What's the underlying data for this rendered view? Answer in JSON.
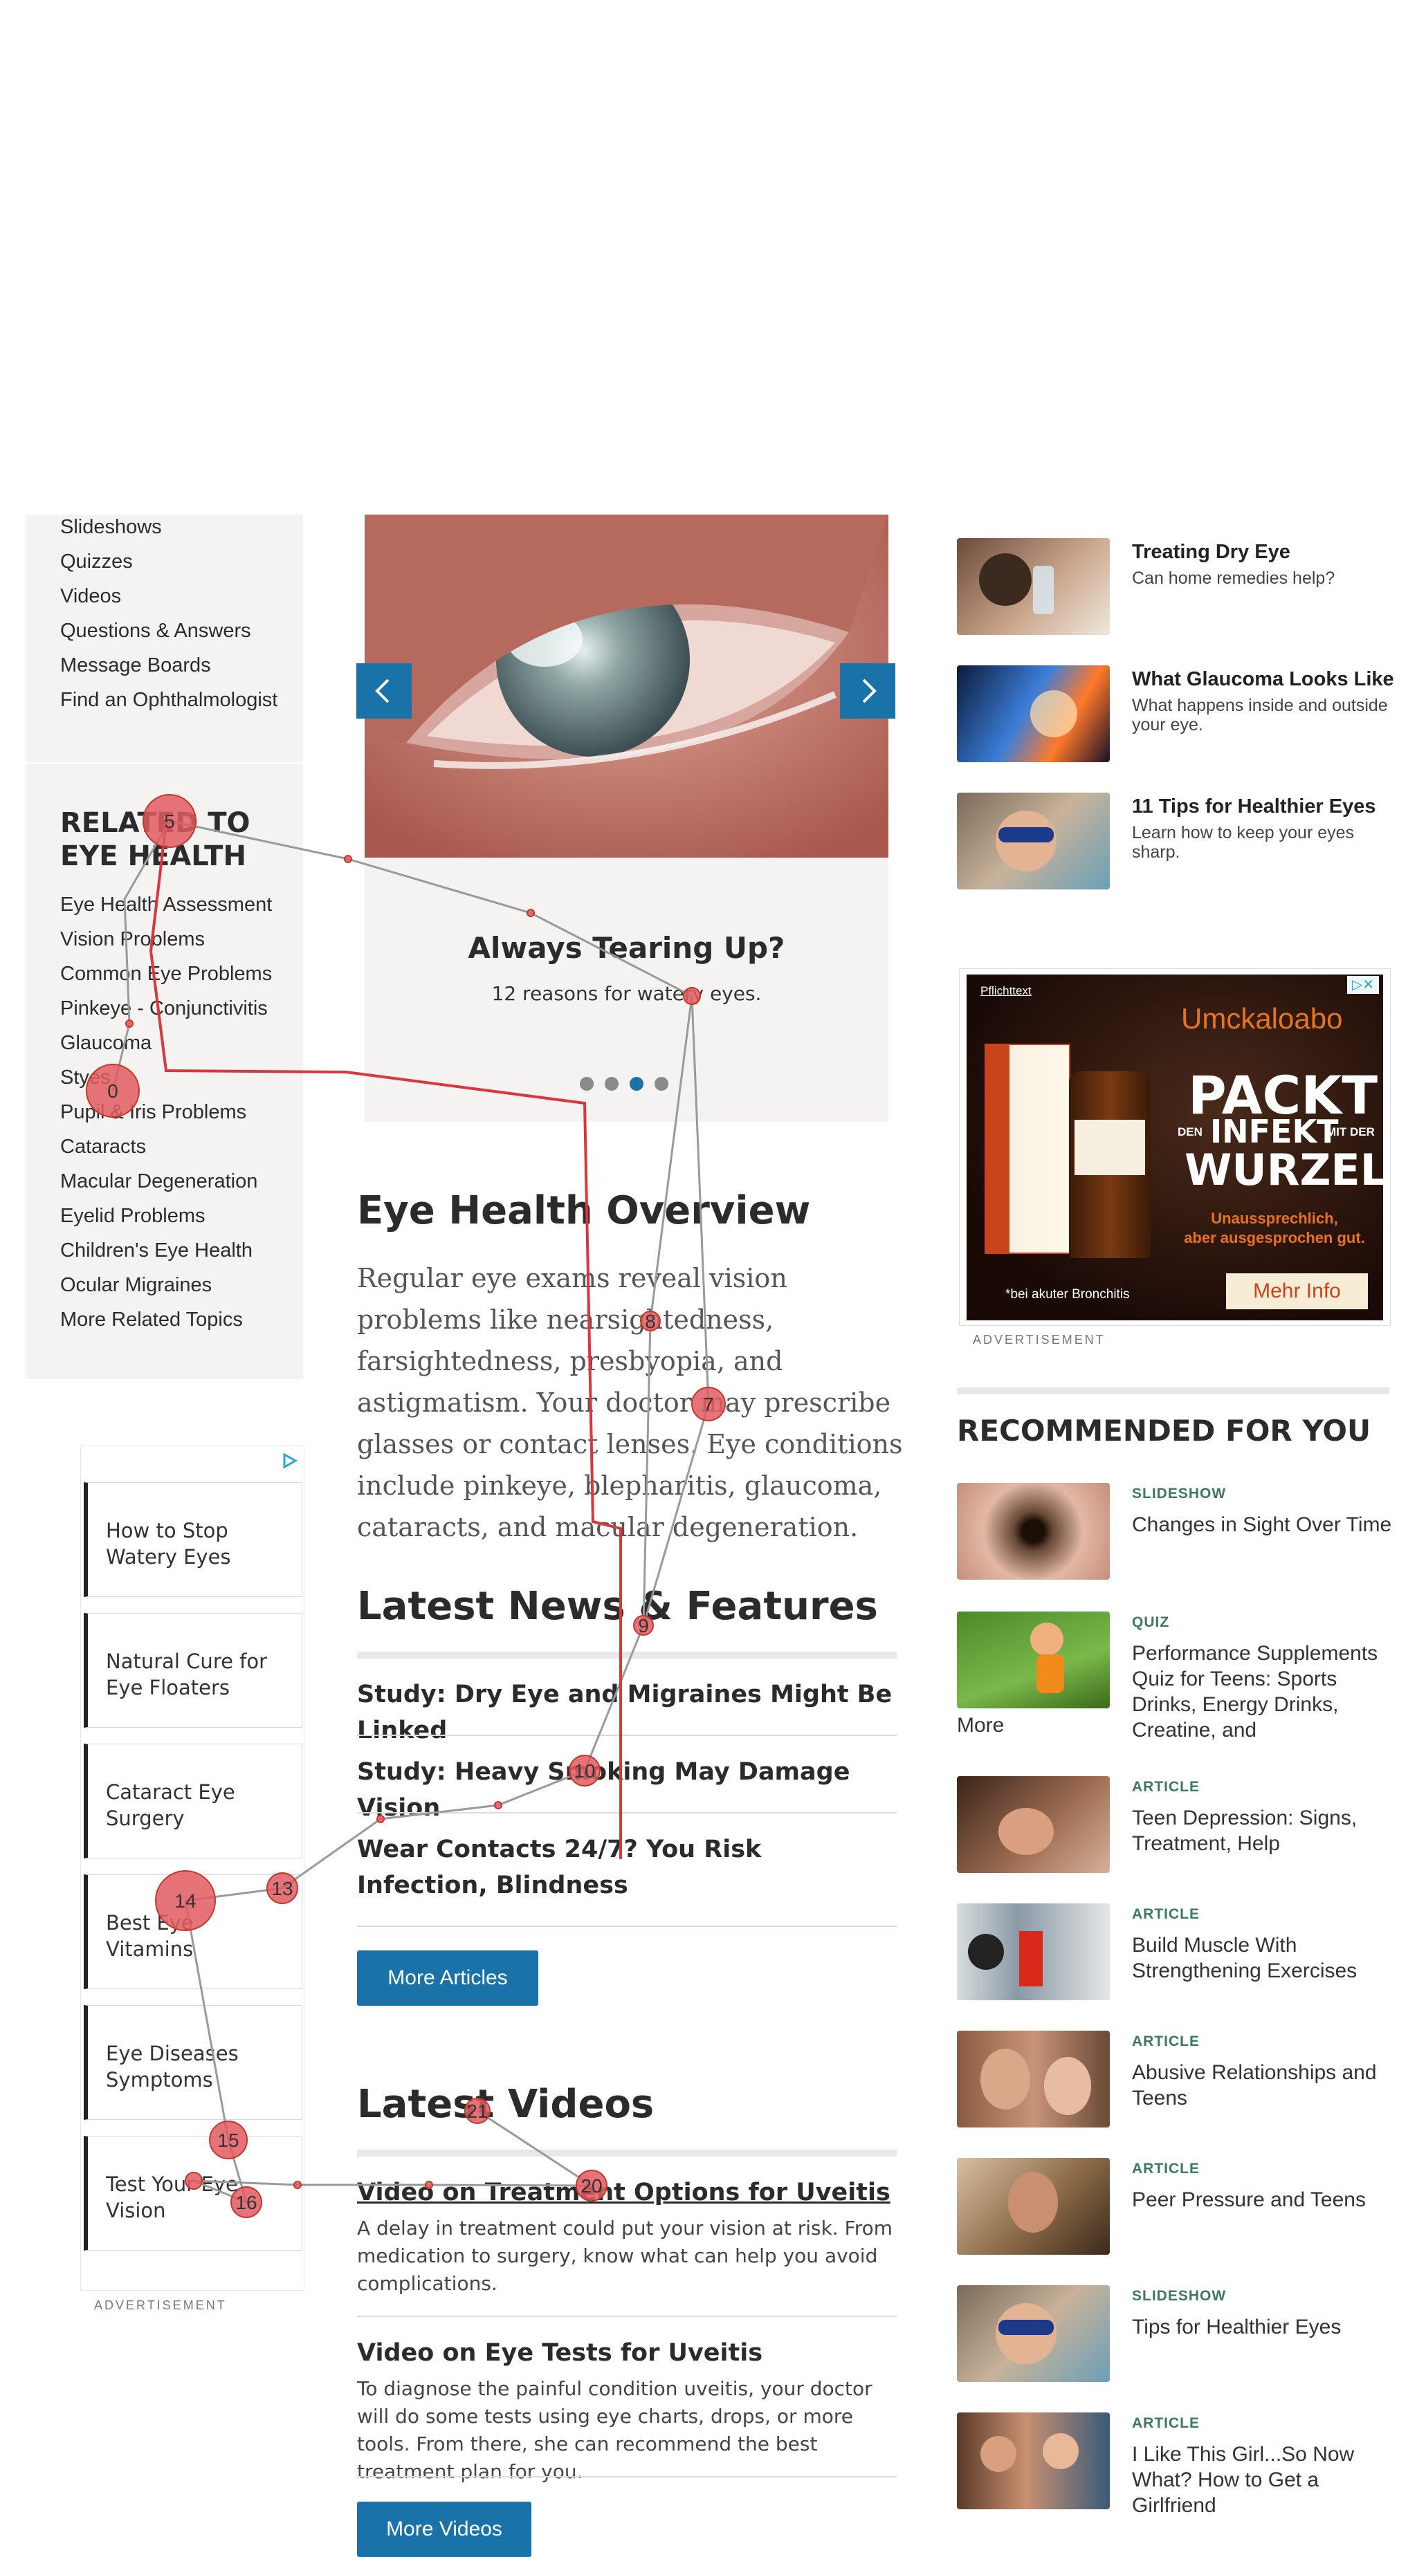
{
  "sidebar": {
    "links": [
      "Slideshows",
      "Quizzes",
      "Videos",
      "Questions & Answers",
      "Message Boards",
      "Find an Ophthalmologist"
    ],
    "related_heading": "RELATED TO EYE HEALTH",
    "related": [
      "Eye Health Assessment",
      "Vision Problems",
      "Common Eye Problems",
      "Pinkeye - Conjunctivitis",
      "Glaucoma",
      "Styes",
      "Pupil & Iris Problems",
      "Cataracts",
      "Macular Degeneration",
      "Eyelid Problems",
      "Children's Eye Health",
      "Ocular Migraines",
      "More Related Topics"
    ]
  },
  "left_ads": {
    "items": [
      "How to Stop Watery Eyes",
      "Natural Cure for Eye Floaters",
      "Cataract Eye Surgery",
      "Best Eye Vitamins",
      "Eye Diseases Symptoms",
      "Test Your Eye Vision"
    ],
    "label": "ADVERTISEMENT"
  },
  "carousel": {
    "title": "Always Tearing Up?",
    "subtitle": "12 reasons for watery eyes.",
    "prev": "‹",
    "next": "›",
    "active_dot": 2
  },
  "overview": {
    "heading": "Eye Health Overview",
    "body": "Regular eye exams reveal vision problems like nearsightedness, farsightedness, presbyopia, and astigmatism. Your doctor may prescribe glasses or contact lenses. Eye conditions include pinkeye, blepharitis, glaucoma, cataracts, and macular degeneration."
  },
  "news": {
    "heading": "Latest News & Features",
    "items": [
      "Study: Dry Eye and Migraines Might Be Linked",
      "Study: Heavy Smoking May Damage Vision",
      "Wear Contacts 24/7? You Risk Infection, Blindness"
    ],
    "button": "More Articles"
  },
  "videos": {
    "heading": "Latest Videos",
    "items": [
      {
        "title": "Video on Treatment Options for Uveitis",
        "desc": "A delay in treatment could put your vision at risk. From medication to surgery, know what can help you avoid complications."
      },
      {
        "title": "Video on Eye Tests for Uveitis",
        "desc": "To diagnose the painful condition uveitis, your doctor will do some tests using eye charts, drops, or more tools. From there, she can recommend the best treatment plan for you."
      }
    ],
    "button": "More Videos"
  },
  "right_features": [
    {
      "title": "Treating Dry Eye",
      "sub": "Can home remedies help?"
    },
    {
      "title": "What Glaucoma Looks Like",
      "sub": "What happens inside and outside your eye."
    },
    {
      "title": "11 Tips for Healthier Eyes",
      "sub": "Learn how to keep your eyes sharp."
    }
  ],
  "right_ad": {
    "pflicht": "Pflichttext",
    "brand": "Umckaloabo",
    "line1": "PACKT",
    "line2a": "DEN",
    "line2b": "INFEKT",
    "line2c": "MIT DER",
    "line3": "WURZEL",
    "tag1": "Unaussprechlich,",
    "tag2": "aber ausgesprochen gut.",
    "foot": "*bei akuter Bronchitis",
    "cta": "Mehr Info",
    "label": "ADVERTISEMENT"
  },
  "recommended": {
    "heading": "RECOMMENDED FOR YOU",
    "items": [
      {
        "type": "SLIDESHOW",
        "title": "Changes in Sight Over Time"
      },
      {
        "type": "QUIZ",
        "title": "Performance Supplements Quiz for Teens: Sports Drinks, Energy Drinks, Creatine, and",
        "more": "More"
      },
      {
        "type": "ARTICLE",
        "title": "Teen Depression: Signs, Treatment, Help"
      },
      {
        "type": "ARTICLE",
        "title": "Build Muscle With Strengthening Exercises"
      },
      {
        "type": "ARTICLE",
        "title": "Abusive Relationships and Teens"
      },
      {
        "type": "ARTICLE",
        "title": "Peer Pressure and Teens"
      },
      {
        "type": "SLIDESHOW",
        "title": "Tips for Healthier Eyes"
      },
      {
        "type": "ARTICLE",
        "title": "I Like This Girl...So Now What? How to Get a Girlfriend"
      }
    ]
  },
  "gaze": {
    "labels": [
      "0",
      "5",
      "7",
      "8",
      "9",
      "10",
      "13",
      "14",
      "15",
      "16",
      "20",
      "21"
    ]
  }
}
